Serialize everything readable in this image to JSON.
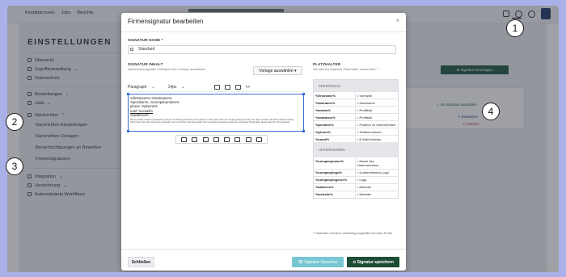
{
  "topbar": {
    "nav": [
      "Kandidat:innen",
      "Jobs",
      "Berichte"
    ]
  },
  "page": {
    "heading": "EINSTELLUNGEN",
    "sidebar": [
      {
        "label": "Übersicht"
      },
      {
        "label": "Zugriffsverwaltung",
        "chevron": "⌄"
      },
      {
        "label": "Datenschutz"
      },
      {
        "label": "Bewerbungen",
        "chevron": "⌄"
      },
      {
        "label": "Jobs",
        "chevron": "⌄"
      },
      {
        "label": "Nachrichten",
        "chevron": "⌃"
      },
      {
        "label": "Nachrichten-Einstellungen"
      },
      {
        "label": "Nachrichten-Vorlagen"
      },
      {
        "label": "Benachrichtigungen an Bewerber"
      },
      {
        "label": "Firmensignaturen"
      },
      {
        "label": "Integration",
        "chevron": "⌄"
      },
      {
        "label": "Verrechnung",
        "chevron": "⌄"
      },
      {
        "label": "Automatisierte Workflows"
      }
    ],
    "add_button": "⊕ Signatur hinzufügen",
    "standard_label": "✓ Als Standard auswählen",
    "edit_label": "✎ Bearbeiten",
    "delete_label": "✕ Löschen"
  },
  "modal": {
    "title": "Firmensignatur bearbeiten",
    "close": "×",
    "name_label": "SIGNATUR NAME *",
    "name_value": "Standard",
    "content_label": "SIGNATUR INHALT",
    "content_hint": "Nachrichtensignatur einfügen oder Vorlage auswählen",
    "template_button": "Vorlage auswählen ▾",
    "toolbar": {
      "format": "Paragraph",
      "size": "14px"
    },
    "editor_lines": [
      "%firstname% %lastname%",
      "%position%, %companyname%",
      "phone: %phone%",
      "mail: %email%",
      "%address%"
    ],
    "editor_fine": "Diese E-Mail enthält vertrauliche und/oder rechtlich geschützte Informationen. Wenn Sie nicht der richtige Adressat sind oder diese E-Mail irrtümlich erhalten haben, informieren Sie bitte sofort den Absender und vernichten Sie diese Mail. Das unerlaubte Kopieren sowie die unbefugte Weitergabe dieser Mail ist nicht gestattet.",
    "placeholder_label": "PLATZHALTER",
    "placeholder_hint": "Sie können folgende Platzhalter verwenden: *",
    "personal_header": "PERSÖNLICH",
    "personal": [
      {
        "key": "%firstname%",
        "value": "Vorname"
      },
      {
        "key": "%lastname%",
        "value": "Nachname"
      },
      {
        "key": "%avatar%",
        "value": "Profilbild"
      },
      {
        "key": "%avatarsrc%",
        "value": "Profilbild"
      },
      {
        "key": "%position%",
        "value": "Position im Unternehmen"
      },
      {
        "key": "%phone%",
        "value": "Telefonnummer"
      },
      {
        "key": "%email%",
        "value": "E-Mail Adresse"
      }
    ],
    "company_header": "UNTERNEHMEN",
    "company": [
      {
        "key": "%companyname%",
        "value": "Name des Unternehmens"
      },
      {
        "key": "%companylogo%",
        "value": "Unternehmens-Logo"
      },
      {
        "key": "%companylogosrc%",
        "value": "Logo"
      },
      {
        "key": "%address%",
        "value": "Adresse"
      },
      {
        "key": "%website%",
        "value": "Website"
      }
    ],
    "footnote": "* Platzhalter erfordern vollständig ausgefüllte Benutzer-Profile.",
    "close_button": "Schließen",
    "preview_button": "👁 Signatur-Vorschau",
    "save_button": "⊙ Signatur speichern"
  },
  "callouts": [
    "1",
    "2",
    "3",
    "4"
  ]
}
